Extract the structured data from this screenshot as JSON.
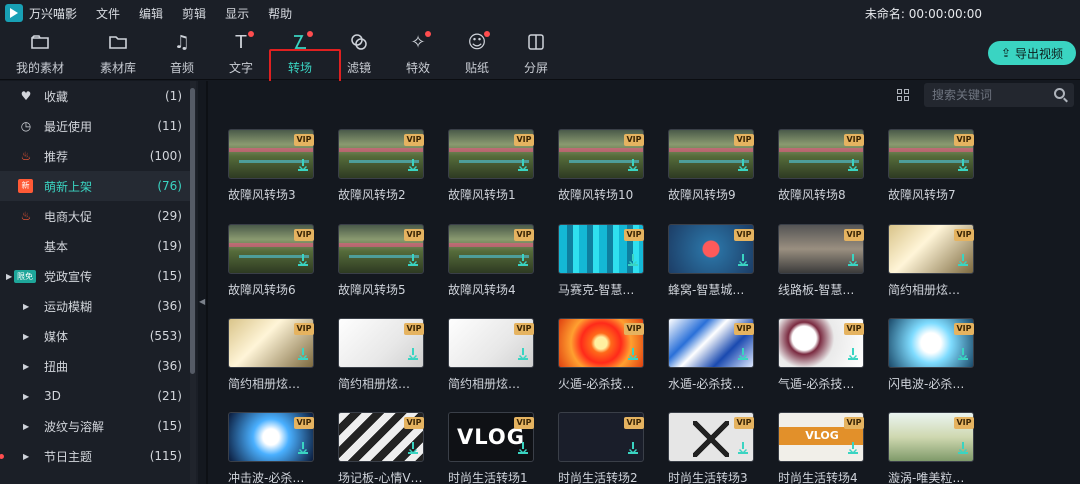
{
  "app": {
    "title": "万兴喵影",
    "project": "未命名: 00:00:00:00"
  },
  "menu": [
    "文件",
    "编辑",
    "剪辑",
    "显示",
    "帮助"
  ],
  "toolbar": {
    "tools": [
      {
        "label": "我的素材",
        "icon": "folder-icon",
        "dot": false
      },
      {
        "label": "素材库",
        "icon": "library-icon",
        "dot": false
      },
      {
        "label": "音频",
        "icon": "music-note-icon",
        "dot": false
      },
      {
        "label": "文字",
        "icon": "text-icon",
        "dot": true
      },
      {
        "label": "转场",
        "icon": "transition-icon",
        "dot": true,
        "active": true
      },
      {
        "label": "滤镜",
        "icon": "filter-icon",
        "dot": false
      },
      {
        "label": "特效",
        "icon": "effects-icon",
        "dot": true
      },
      {
        "label": "贴纸",
        "icon": "sticker-icon",
        "dot": true
      },
      {
        "label": "分屏",
        "icon": "split-screen-icon",
        "dot": false
      }
    ],
    "export_label": "导出视频"
  },
  "sidebar": {
    "items": [
      {
        "label": "收藏",
        "count": "(1)",
        "icon": "heart-icon"
      },
      {
        "label": "最近使用",
        "count": "(11)",
        "icon": "clock-icon"
      },
      {
        "label": "推荐",
        "count": "(100)",
        "icon": "fire-icon"
      },
      {
        "label": "萌新上架",
        "count": "(76)",
        "icon": "new-badge-icon",
        "badge": "新",
        "active": true
      },
      {
        "label": "电商大促",
        "count": "(29)",
        "icon": "fire-icon"
      },
      {
        "label": "基本",
        "count": "(19)"
      },
      {
        "label": "党政宣传",
        "count": "(15)",
        "badge": "限免",
        "arrow": true
      },
      {
        "label": "运动模糊",
        "count": "(36)",
        "arrow": true
      },
      {
        "label": "媒体",
        "count": "(553)",
        "arrow": true
      },
      {
        "label": "扭曲",
        "count": "(36)",
        "arrow": true
      },
      {
        "label": "3D",
        "count": "(21)",
        "arrow": true
      },
      {
        "label": "波纹与溶解",
        "count": "(15)",
        "arrow": true
      },
      {
        "label": "节日主题",
        "count": "(115)",
        "arrow": true,
        "dot": true
      }
    ]
  },
  "search": {
    "placeholder": "搜索关键词"
  },
  "grid": {
    "vip_label": "VIP",
    "items": [
      {
        "name": "故障风转场3",
        "style": "glitch"
      },
      {
        "name": "故障风转场2",
        "style": "glitch"
      },
      {
        "name": "故障风转场1",
        "style": "glitch"
      },
      {
        "name": "故障风转场10",
        "style": "glitch"
      },
      {
        "name": "故障风转场9",
        "style": "glitch"
      },
      {
        "name": "故障风转场8",
        "style": "glitch"
      },
      {
        "name": "故障风转场7",
        "style": "glitch"
      },
      {
        "name": "故障风转场6",
        "style": "glitch"
      },
      {
        "name": "故障风转场5",
        "style": "glitch"
      },
      {
        "name": "故障风转场4",
        "style": "glitch"
      },
      {
        "name": "马赛克-智慧…",
        "style": "mosaic"
      },
      {
        "name": "蜂窝-智慧城…",
        "style": "hive"
      },
      {
        "name": "线路板-智慧…",
        "style": "line"
      },
      {
        "name": "简约相册炫…",
        "style": "album"
      },
      {
        "name": "简约相册炫…",
        "style": "album"
      },
      {
        "name": "简约相册炫…",
        "style": "white"
      },
      {
        "name": "简约相册炫…",
        "style": "white"
      },
      {
        "name": "火遁-必杀技…",
        "style": "fire"
      },
      {
        "name": "水遁-必杀技…",
        "style": "water"
      },
      {
        "name": "气遁-必杀技…",
        "style": "air"
      },
      {
        "name": "闪电波-必杀…",
        "style": "bolt"
      },
      {
        "name": "冲击波-必杀…",
        "style": "shock"
      },
      {
        "name": "场记板-心情V…",
        "style": "clap"
      },
      {
        "name": "时尚生活转场1",
        "style": "vlog",
        "text": "VLOG"
      },
      {
        "name": "时尚生活转场2",
        "style": "dark"
      },
      {
        "name": "时尚生活转场3",
        "style": "vlogx"
      },
      {
        "name": "时尚生活转场4",
        "style": "vlog4",
        "text": "VLOG"
      },
      {
        "name": "漩涡-唯美粒…",
        "style": "wave"
      }
    ]
  },
  "colors": {
    "accent": "#3ad4c2",
    "background": "#14181f",
    "panel": "#1b1f27",
    "vip": "#e5b360",
    "badge_red": "#ff4d4f"
  }
}
